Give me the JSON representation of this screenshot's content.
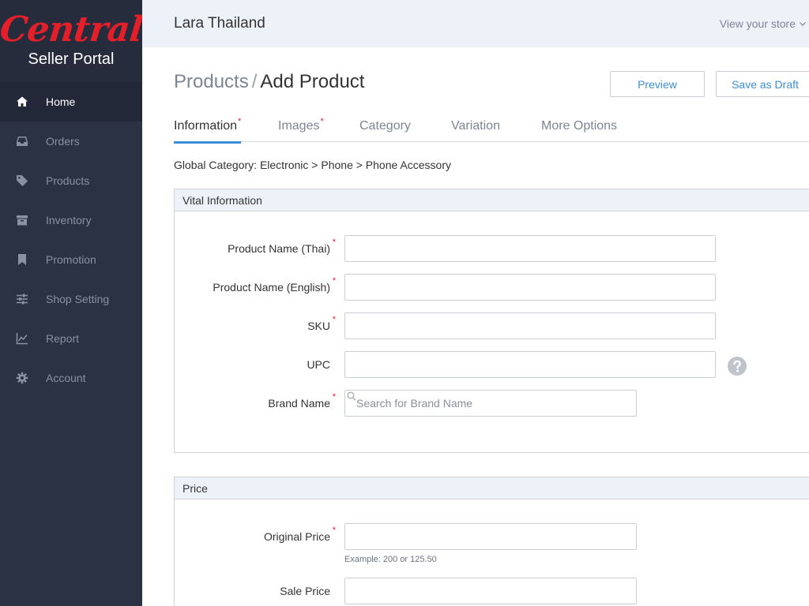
{
  "brand": {
    "logo_text": "Central",
    "subtitle": "Seller Portal"
  },
  "sidebar": {
    "items": [
      {
        "label": "Home",
        "icon": "home-icon",
        "active": true
      },
      {
        "label": "Orders",
        "icon": "inbox-icon",
        "active": false
      },
      {
        "label": "Products",
        "icon": "tag-icon",
        "active": false
      },
      {
        "label": "Inventory",
        "icon": "archive-icon",
        "active": false
      },
      {
        "label": "Promotion",
        "icon": "bookmark-icon",
        "active": false
      },
      {
        "label": "Shop Setting",
        "icon": "sliders-icon",
        "active": false
      },
      {
        "label": "Report",
        "icon": "line-chart-icon",
        "active": false
      },
      {
        "label": "Account",
        "icon": "gear-icon",
        "active": false
      }
    ]
  },
  "header": {
    "store_name": "Lara Thailand",
    "view_store": "View your store"
  },
  "page": {
    "breadcrumb_parent": "Products",
    "breadcrumb_separator": "/",
    "title": "Add Product",
    "preview_label": "Preview",
    "draft_label": "Save as Draft"
  },
  "tabs": [
    {
      "label": "Information",
      "required": true,
      "active": true
    },
    {
      "label": "Images",
      "required": true,
      "active": false
    },
    {
      "label": "Category",
      "required": false,
      "active": false
    },
    {
      "label": "Variation",
      "required": false,
      "active": false
    },
    {
      "label": "More Options",
      "required": false,
      "active": false
    }
  ],
  "global_category": "Global Category: Electronic > Phone > Phone Accessory",
  "required_mark": "*",
  "vital": {
    "title": "Vital Information",
    "product_name_thai_label": "Product Name (Thai)",
    "product_name_thai_value": "",
    "product_name_english_label": "Product Name (English)",
    "product_name_english_value": "",
    "sku_label": "SKU",
    "sku_value": "",
    "upc_label": "UPC",
    "upc_value": "",
    "brand_label": "Brand Name",
    "brand_placeholder": "Search for Brand Name"
  },
  "price": {
    "title": "Price",
    "original_label": "Original Price",
    "original_value": "",
    "original_hint": "Example: 200 or 125.50",
    "sale_label": "Sale Price",
    "sale_value": ""
  },
  "colors": {
    "accent": "#3b8fd9",
    "required": "#e3202a",
    "sidebar": "#2b3244",
    "brand": "#e3202a"
  }
}
